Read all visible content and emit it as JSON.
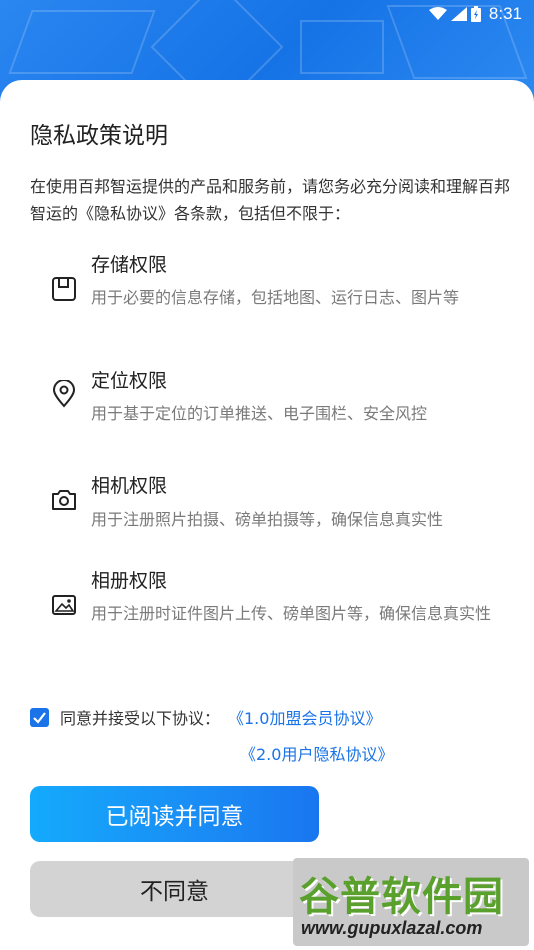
{
  "status_bar": {
    "time": "8:31",
    "icons": [
      "wifi-icon",
      "signal-icon",
      "battery-icon"
    ]
  },
  "dialog": {
    "title": "隐私政策说明",
    "intro": "在使用百邦智运提供的产品和服务前，请您务必充分阅读和理解百邦智运的《隐私协议》各条款，包括但不限于：",
    "permissions": [
      {
        "icon": "storage-icon",
        "name": "存储权限",
        "desc": "用于必要的信息存储，包括地图、运行日志、图片等"
      },
      {
        "icon": "location-icon",
        "name": "定位权限",
        "desc": "用于基于定位的订单推送、电子围栏、安全风控"
      },
      {
        "icon": "camera-icon",
        "name": "相机权限",
        "desc": "用于注册照片拍摄、磅单拍摄等，确保信息真实性"
      },
      {
        "icon": "image-icon",
        "name": "相册权限",
        "desc": "用于注册时证件图片上传、磅单图片等，确保信息真实性"
      }
    ],
    "agreement": {
      "checked": true,
      "label": "同意并接受以下协议：",
      "links": [
        "《1.0加盟会员协议》",
        "《2.0用户隐私协议》"
      ]
    },
    "accept_button": "已阅读并同意",
    "decline_button": "不同意"
  },
  "watermark": {
    "main": "谷普软件园",
    "url": "www.gupuxlazal.com"
  },
  "colors": {
    "accent": "#1a73e8",
    "header_blue": "#1a7ae8",
    "button_gradient_start": "#14aafc",
    "button_gradient_end": "#1976f0",
    "decline_bg": "#d3d3d3",
    "desc_text": "#7a7a7a"
  }
}
